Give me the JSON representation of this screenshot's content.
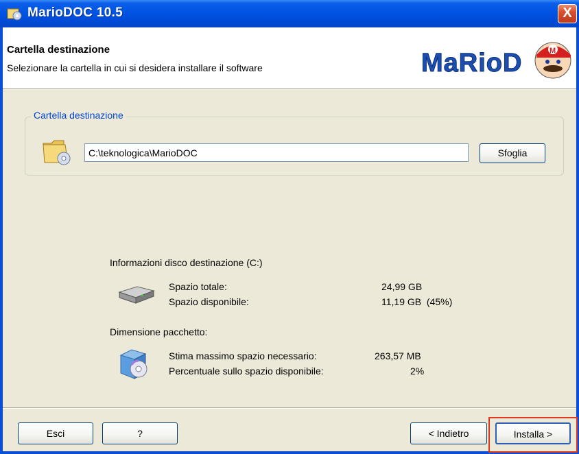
{
  "window": {
    "title": "MarioDOC 10.5",
    "close_label": "X"
  },
  "header": {
    "title": "Cartella destinazione",
    "subtitle": "Selezionare la cartella in cui si desidera installare il software",
    "logo_text": "MaRioDOC"
  },
  "destination": {
    "legend": "Cartella destinazione",
    "path_value": "C:\\teknologica\\MarioDOC",
    "browse_label": "Sfoglia"
  },
  "disk_info": {
    "heading": "Informazioni disco destinazione (C:)",
    "total_label": "Spazio totale:",
    "total_value": "24,99 GB",
    "available_label": "Spazio disponibile:",
    "available_value": "11,19 GB  (45%)"
  },
  "package_info": {
    "heading": "Dimensione pacchetto:",
    "max_space_label": "Stima massimo spazio necessario:",
    "max_space_value": "263,57 MB",
    "percent_label": "Percentuale sullo spazio disponibile:",
    "percent_value": "2%"
  },
  "buttons": {
    "exit": "Esci",
    "help": "?",
    "back": "< Indietro",
    "install": "Installa >"
  },
  "colors": {
    "titlebar": "#0054e3",
    "legend_text": "#0046d5",
    "highlight": "#e03a1e"
  }
}
